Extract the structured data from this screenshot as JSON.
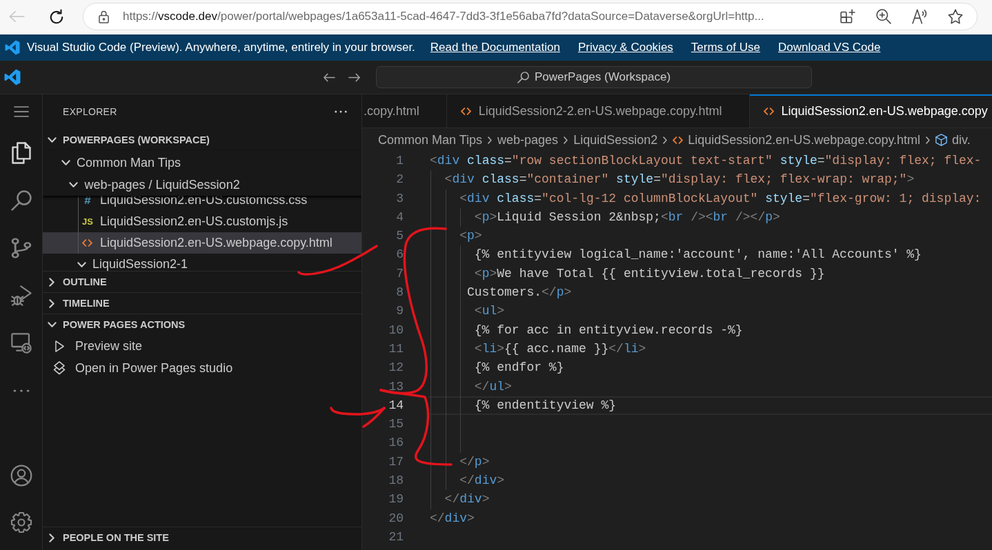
{
  "browser": {
    "back_disabled": true,
    "address": {
      "scheme": "https://",
      "host": "vscode.dev",
      "path": "/power/portal/webpages/1a653a11-5cad-4647-7dd3-3f1e56aba7fd?dataSource=Dataverse&orgUrl=http..."
    }
  },
  "banner": {
    "message": "Visual Studio Code (Preview). Anywhere, anytime, entirely in your browser.",
    "links": [
      "Read the Documentation",
      "Privacy & Cookies",
      "Terms of Use",
      "Download VS Code"
    ]
  },
  "title_bar": {
    "command_center": "PowerPages (Workspace)"
  },
  "activity_bar": {
    "items": [
      {
        "kind": "menu",
        "selected": false
      },
      {
        "kind": "explorer",
        "selected": true
      },
      {
        "kind": "search",
        "selected": false
      },
      {
        "kind": "source-control",
        "selected": false
      },
      {
        "kind": "run-debug",
        "selected": false
      },
      {
        "kind": "remote",
        "selected": false
      },
      {
        "kind": "more",
        "selected": false
      }
    ],
    "bottom": [
      {
        "kind": "account"
      },
      {
        "kind": "manage"
      }
    ]
  },
  "sidebar": {
    "title": "EXPLORER",
    "sections": [
      {
        "title": "POWERPAGES (WORKSPACE)",
        "expanded": true,
        "tree": [
          {
            "label": "Common Man Tips",
            "kind": "folder",
            "expanded": true,
            "selected": false,
            "children": [
              {
                "label": "web-pages / LiquidSession2",
                "kind": "folder",
                "expanded": true,
                "selected": false,
                "children": [
                  {
                    "label": "LiquidSession2.en-US.customcss.css",
                    "kind": "css",
                    "glyph": "#",
                    "selected": false
                  },
                  {
                    "label": "LiquidSession2.en-US.customjs.js",
                    "kind": "js",
                    "glyph": "JS",
                    "selected": false
                  },
                  {
                    "label": "LiquidSession2.en-US.webpage.copy.html",
                    "kind": "html",
                    "selected": true
                  },
                  {
                    "label": "LiquidSession2-1",
                    "kind": "folder",
                    "expanded": true,
                    "selected": false
                  }
                ]
              }
            ]
          }
        ]
      },
      {
        "title": "OUTLINE",
        "expanded": false
      },
      {
        "title": "TIMELINE",
        "expanded": false
      },
      {
        "title": "POWER PAGES ACTIONS",
        "expanded": true,
        "actions": [
          {
            "label": "Preview site",
            "kind": "preview"
          },
          {
            "label": "Open in Power Pages studio",
            "kind": "studio"
          }
        ]
      },
      {
        "title": "PEOPLE ON THE SITE",
        "expanded": false
      }
    ]
  },
  "editor": {
    "tabs": [
      {
        "label": ".copy.html",
        "kind": "clipped",
        "selected": false
      },
      {
        "label": "LiquidSession2-2.en-US.webpage.copy.html",
        "kind": "html",
        "selected": false
      },
      {
        "label": "LiquidSession2.en-US.webpage.copy",
        "kind": "html",
        "selected": true
      }
    ],
    "breadcrumbs": [
      {
        "label": "Common Man Tips",
        "kind": "folder"
      },
      {
        "label": "web-pages",
        "kind": "folder"
      },
      {
        "label": "LiquidSession2",
        "kind": "folder"
      },
      {
        "label": "LiquidSession2.en-US.webpage.copy.html",
        "kind": "html"
      },
      {
        "label": "div.",
        "kind": "element"
      }
    ],
    "lines": [
      {
        "number": "1",
        "text": "<div class=\"row sectionBlockLayout text-start\" style=\"display: flex; flex-",
        "current": false
      },
      {
        "number": "2",
        "text": "  <div class=\"container\" style=\"display: flex; flex-wrap: wrap;\">",
        "current": false
      },
      {
        "number": "3",
        "text": "    <div class=\"col-lg-12 columnBlockLayout\" style=\"flex-grow: 1; display:",
        "current": false
      },
      {
        "number": "4",
        "text": "      <p>Liquid Session 2&nbsp;<br /><br /></p>",
        "current": false
      },
      {
        "number": "5",
        "text": "    <p>",
        "current": false
      },
      {
        "number": "6",
        "text": "      {% entityview logical_name:'account', name:'All Accounts' %}",
        "current": false
      },
      {
        "number": "7",
        "text": "      <p>We have Total {{ entityview.total_records }}",
        "current": false
      },
      {
        "number": "8",
        "text": "     Customers.</p>",
        "current": false
      },
      {
        "number": "9",
        "text": "      <ul>",
        "current": false
      },
      {
        "number": "10",
        "text": "      {% for acc in entityview.records -%}",
        "current": false
      },
      {
        "number": "11",
        "text": "      <li>{{ acc.name }}</li>",
        "current": false
      },
      {
        "number": "12",
        "text": "      {% endfor %}",
        "current": false
      },
      {
        "number": "13",
        "text": "      </ul>",
        "current": false
      },
      {
        "number": "14",
        "text": "      {% endentityview %}",
        "current": true
      },
      {
        "number": "15",
        "current": false
      },
      {
        "number": "16",
        "current": false
      },
      {
        "number": "17",
        "text": "    </p>",
        "current": false
      },
      {
        "number": "18",
        "text": "    </div>",
        "current": false
      },
      {
        "number": "19",
        "text": "  </div>",
        "current": false
      },
      {
        "number": "20",
        "text": "</div>",
        "current": false
      },
      {
        "number": "21",
        "current": false
      }
    ]
  }
}
